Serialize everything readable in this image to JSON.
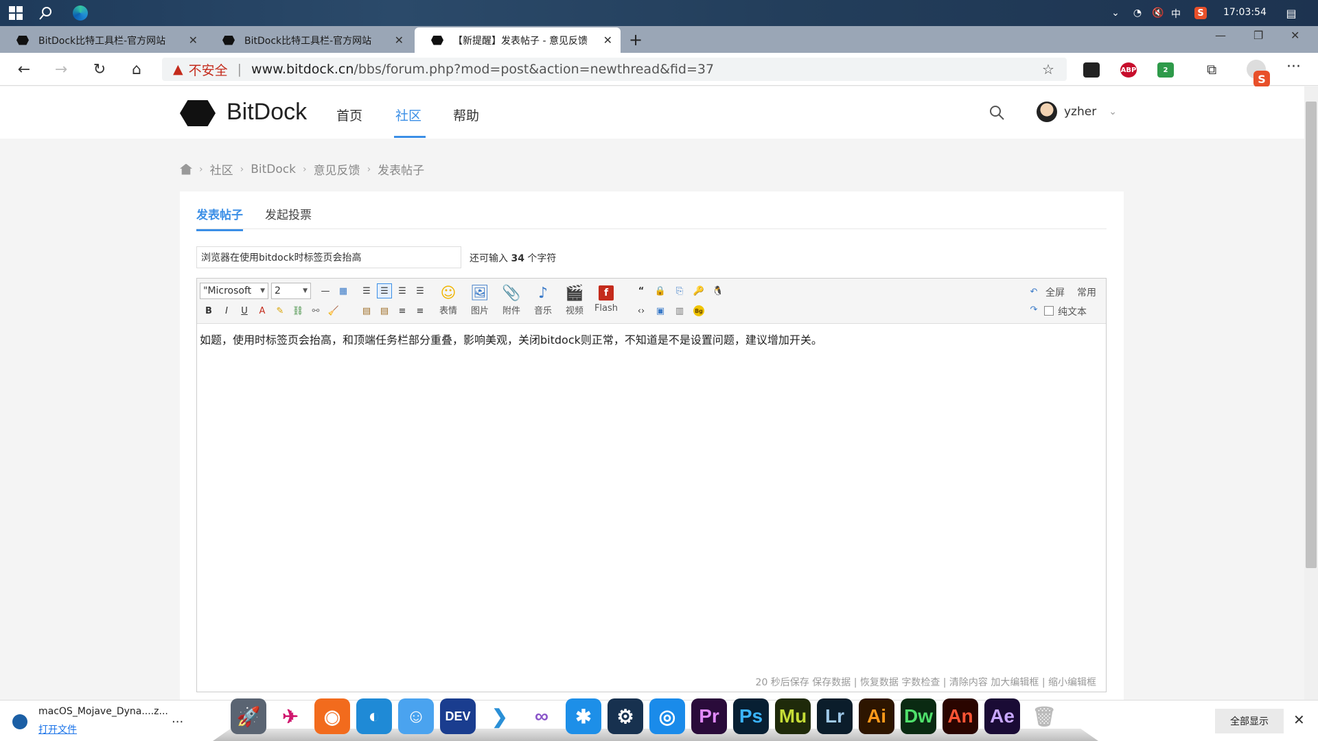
{
  "system_bar": {
    "clock": "17:03:54",
    "ime_label": "中",
    "tray_icons": [
      "chevron-up-icon",
      "wifi-icon",
      "volume-muted-icon",
      "ime-icon",
      "sogou-icon",
      "notification-icon"
    ]
  },
  "browser": {
    "tabs": [
      {
        "label": "BitDock比特工具栏-官方网站",
        "active": false
      },
      {
        "label": "BitDock比特工具栏-官方网站",
        "active": false
      },
      {
        "label": "【新提醒】发表帖子 - 意见反馈",
        "active": true
      }
    ],
    "new_tab": "+",
    "address": {
      "security_label": "不安全",
      "host": "www.bitdock.cn",
      "path": "/bbs/forum.php?mod=post&action=newthread&fid=37"
    },
    "extensions": [
      {
        "name": "dock-extension-icon",
        "label": "",
        "color": "#222222"
      },
      {
        "name": "adblock-plus-icon",
        "label": "ABP",
        "color": "#c70d2c"
      },
      {
        "name": "shield-extension-icon",
        "label": "2",
        "color": "#2e9a4a"
      }
    ]
  },
  "site": {
    "logo_text": "BitDock",
    "nav": [
      "首页",
      "社区",
      "帮助"
    ],
    "active_nav": "社区",
    "user_name": "yzher"
  },
  "breadcrumb": [
    "社区",
    "BitDock",
    "意见反馈",
    "发表帖子"
  ],
  "post_form": {
    "tabs": [
      "发表帖子",
      "发起投票"
    ],
    "subject_value": "浏览器在使用bitdock时标签页会抬高",
    "remain_prefix": "还可输入",
    "remain_count": "34",
    "remain_suffix": "个字符",
    "font_select": "\"Microsoft",
    "size_select": "2",
    "big_buttons": [
      {
        "label": "表情",
        "icon": "emoji-icon"
      },
      {
        "label": "图片",
        "icon": "image-icon"
      },
      {
        "label": "附件",
        "icon": "attachment-icon"
      },
      {
        "label": "音乐",
        "icon": "music-icon"
      },
      {
        "label": "视频",
        "icon": "video-icon"
      },
      {
        "label": "Flash",
        "icon": "flash-icon"
      }
    ],
    "right_tools": {
      "fullscreen": "全屏",
      "common": "常用",
      "plain_text": "纯文本"
    },
    "body_text": "如题，使用时标签页会抬高，和顶端任务栏部分重叠，影响美观，关闭bitdock则正常，不知道是不是设置问题，建议增加开关。",
    "footer_links": "20 秒后保存 保存数据 | 恢复数据    字数检查 | 清除内容    加大编辑框 | 缩小编辑框"
  },
  "download_bar": {
    "file_name": "macOS_Mojave_Dyna....z...",
    "open_label": "打开文件",
    "more": "...",
    "show_all": "全部显示"
  },
  "dock_apps": [
    {
      "name": "launchpad-rocket-icon",
      "label": "",
      "bg": "#5a6472",
      "fg": "#ffffff"
    },
    {
      "name": "paper-plane-app-icon",
      "label": "",
      "bg": "transparent",
      "fg": "#d0176e"
    },
    {
      "name": "firefox-icon",
      "label": "",
      "bg": "#f26b1d",
      "fg": "#ffffff"
    },
    {
      "name": "edge-icon",
      "label": "",
      "bg": "#1f8ad6",
      "fg": "#ffffff"
    },
    {
      "name": "finder-icon",
      "label": "",
      "bg": "#4aa3ef",
      "fg": "#ffffff"
    },
    {
      "name": "dev-cpp-icon",
      "label": "DEV",
      "bg": "#1a3d8f",
      "fg": "#ffffff"
    },
    {
      "name": "vscode-icon",
      "label": "",
      "bg": "transparent",
      "fg": "#2a8fd6"
    },
    {
      "name": "visual-studio-icon",
      "label": "",
      "bg": "transparent",
      "fg": "#8a55c9"
    },
    {
      "name": "bitdock-app-icon",
      "label": "",
      "bg": "#1d8fe8",
      "fg": "#ffffff"
    },
    {
      "name": "steam-icon",
      "label": "",
      "bg": "#17314f",
      "fg": "#ffffff"
    },
    {
      "name": "uplay-icon",
      "label": "",
      "bg": "#1a8bea",
      "fg": "#ffffff"
    },
    {
      "name": "premiere-icon",
      "label": "Pr",
      "bg": "#2a0b3a",
      "fg": "#e28bff"
    },
    {
      "name": "photoshop-icon",
      "label": "Ps",
      "bg": "#071f33",
      "fg": "#3bb4ff"
    },
    {
      "name": "muse-icon",
      "label": "Mu",
      "bg": "#1f2a0a",
      "fg": "#c6dd36"
    },
    {
      "name": "lightroom-icon",
      "label": "Lr",
      "bg": "#0b1d2b",
      "fg": "#9ec8e8"
    },
    {
      "name": "illustrator-icon",
      "label": "Ai",
      "bg": "#2d1500",
      "fg": "#ff9a1a"
    },
    {
      "name": "dreamweaver-icon",
      "label": "Dw",
      "bg": "#0a2a12",
      "fg": "#4fe06b"
    },
    {
      "name": "animate-icon",
      "label": "An",
      "bg": "#2a0500",
      "fg": "#ff5535"
    },
    {
      "name": "after-effects-icon",
      "label": "Ae",
      "bg": "#1a0b35",
      "fg": "#c9a8ff"
    },
    {
      "name": "trash-icon",
      "label": "",
      "bg": "transparent",
      "fg": "#bbbbbb"
    }
  ],
  "colors": {
    "accent": "#3a8ee6",
    "danger": "#c42b1c"
  }
}
